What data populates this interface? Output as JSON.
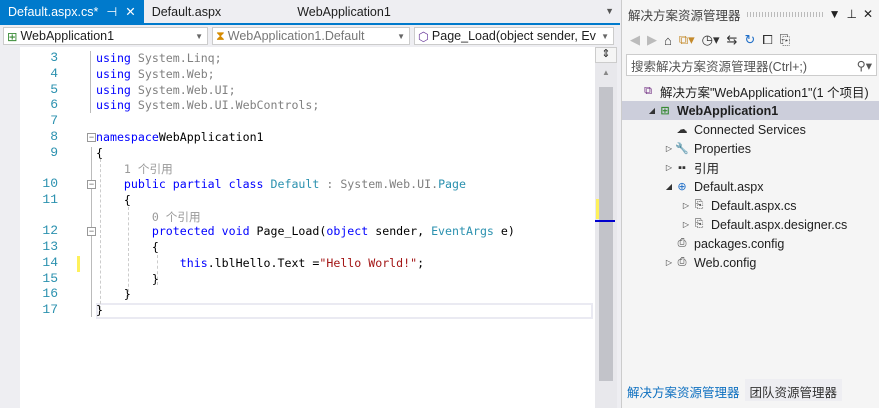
{
  "tabs": [
    {
      "label": "Default.aspx.cs*",
      "active": true,
      "pin": "⊣",
      "close": "✕"
    },
    {
      "label": "Default.aspx"
    },
    {
      "label": "WebApplication1"
    }
  ],
  "nav": {
    "project": "WebApplication1",
    "class": "WebApplication1.Default",
    "member": "Page_Load(object sender, Ev"
  },
  "code": [
    {
      "n": "3",
      "t": [
        [
          "kw",
          "using"
        ],
        [
          "gr",
          " System.Linq;"
        ]
      ]
    },
    {
      "n": "4",
      "t": [
        [
          "kw",
          "using"
        ],
        [
          "gr",
          " System.Web;"
        ]
      ]
    },
    {
      "n": "5",
      "t": [
        [
          "kw",
          "using"
        ],
        [
          "gr",
          " System.Web.UI;"
        ]
      ]
    },
    {
      "n": "6",
      "t": [
        [
          "kw",
          "using"
        ],
        [
          "gr",
          " System.Web.UI.WebControls;"
        ]
      ]
    },
    {
      "n": "7",
      "t": []
    },
    {
      "n": "8",
      "t": [
        [
          "kw",
          "namespace"
        ],
        [
          "",
          "WebApplication1"
        ]
      ],
      "fold": true
    },
    {
      "n": "9",
      "t": [
        [
          "",
          "{"
        ]
      ]
    },
    {
      "n": "",
      "t": [
        [
          "lens",
          "    1 个引用"
        ]
      ]
    },
    {
      "n": "10",
      "t": [
        [
          "",
          "    "
        ],
        [
          "kw",
          "public partial class "
        ],
        [
          "ty",
          "Default"
        ],
        [
          "gr",
          " : System.Web.UI."
        ],
        [
          "ty",
          "Page"
        ]
      ],
      "fold": true
    },
    {
      "n": "11",
      "t": [
        [
          "",
          "    {"
        ]
      ]
    },
    {
      "n": "",
      "t": [
        [
          "lens",
          "        0 个引用"
        ]
      ]
    },
    {
      "n": "12",
      "t": [
        [
          "",
          "        "
        ],
        [
          "kw",
          "protected void "
        ],
        [
          "",
          "Page_Load("
        ],
        [
          "kw",
          "object"
        ],
        [
          "",
          " sender, "
        ],
        [
          "ty",
          "EventArgs"
        ],
        [
          "",
          " e)"
        ]
      ],
      "fold": true
    },
    {
      "n": "13",
      "t": [
        [
          "",
          "        {"
        ]
      ]
    },
    {
      "n": "14",
      "t": [
        [
          "",
          "            "
        ],
        [
          "kw",
          "this"
        ],
        [
          "",
          ".lblHello.Text ="
        ],
        [
          "st",
          "\"Hello World!\""
        ],
        [
          "",
          ";"
        ]
      ]
    },
    {
      "n": "15",
      "t": [
        [
          "",
          "        }"
        ]
      ]
    },
    {
      "n": "16",
      "t": [
        [
          "",
          "    }"
        ]
      ]
    },
    {
      "n": "17",
      "t": [
        [
          "",
          "}"
        ]
      ]
    }
  ],
  "panel": {
    "title": "解决方案资源管理器",
    "search_placeholder": "搜索解决方案资源管理器(Ctrl+;)",
    "tree": [
      {
        "label": "解决方案\"WebApplication1\"(1 个项目)",
        "icon": "solution-icon",
        "glyph": "⧉",
        "level": 0,
        "exp": ""
      },
      {
        "label": "WebApplication1",
        "icon": "web-project-icon",
        "glyph": "⊞",
        "level": 1,
        "exp": "◢",
        "sel": true
      },
      {
        "label": "Connected Services",
        "icon": "cloud-icon",
        "glyph": "☁",
        "level": 2,
        "exp": ""
      },
      {
        "label": "Properties",
        "icon": "wrench-icon",
        "glyph": "🔧",
        "level": 2,
        "exp": "▷"
      },
      {
        "label": "引用",
        "icon": "references-icon",
        "glyph": "▪▪",
        "level": 2,
        "exp": "▷"
      },
      {
        "label": "Default.aspx",
        "icon": "web-page-icon",
        "glyph": "⊕",
        "level": 2,
        "exp": "◢"
      },
      {
        "label": "Default.aspx.cs",
        "icon": "cs-file-icon",
        "glyph": "⎘",
        "level": 3,
        "exp": "▷"
      },
      {
        "label": "Default.aspx.designer.cs",
        "icon": "cs-file-icon",
        "glyph": "⎘",
        "level": 3,
        "exp": "▷"
      },
      {
        "label": "packages.config",
        "icon": "config-file-icon",
        "glyph": "⎙",
        "level": 2,
        "exp": ""
      },
      {
        "label": "Web.config",
        "icon": "config-file-icon",
        "glyph": "⎙",
        "level": 2,
        "exp": "▷"
      }
    ],
    "bottom_tabs": [
      "解决方案资源管理器",
      "团队资源管理器"
    ]
  },
  "colors": {
    "accent": "#007acc",
    "keyword": "#0000ff",
    "type": "#2b91af",
    "string": "#a31515"
  }
}
